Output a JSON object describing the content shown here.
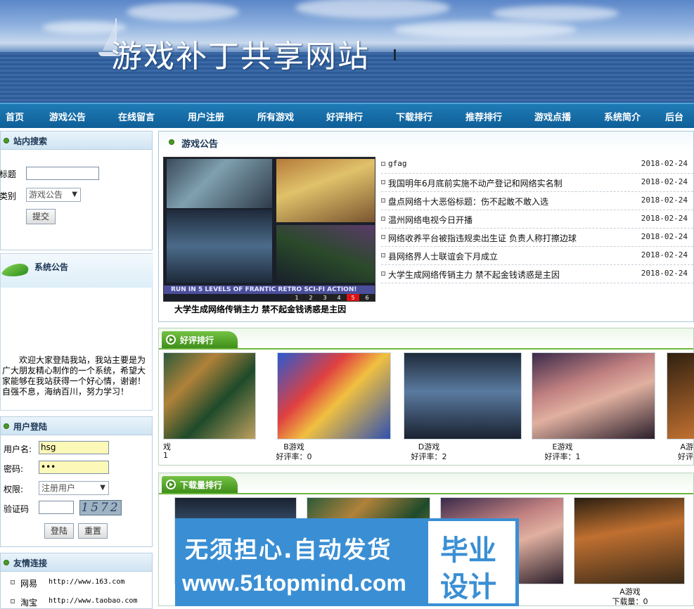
{
  "site_title": "游戏补丁共享网站",
  "nav": [
    "首页",
    "游戏公告",
    "在线留言",
    "用户注册",
    "所有游戏",
    "好评排行",
    "下载排行",
    "推荐排行",
    "游戏点播",
    "系统简介",
    "后台"
  ],
  "search": {
    "heading": "站内搜索",
    "title_label": "标题",
    "category_label": "类别",
    "category_value": "游戏公告",
    "submit_label": "提交"
  },
  "announcement": {
    "heading": "系统公告",
    "text": "欢迎大家登陆我站，我站主要是为广大朋友精心制作的一个系统，希望大家能够在我站获得一个好心情，谢谢！ 自强不息，海纳百川，努力学习！"
  },
  "login": {
    "heading": "用户登陆",
    "username_label": "用户名:",
    "username_value": "hsg",
    "password_label": "密码:",
    "password_value": "•••",
    "role_label": "权限:",
    "role_value": "注册用户",
    "captcha_label": "验证码",
    "captcha_value": "1572",
    "login_button": "登陆",
    "reset_button": "重置"
  },
  "links": {
    "heading": "友情连接",
    "items": [
      {
        "name": "网易",
        "url": "http://www.163.com"
      },
      {
        "name": "淘宝",
        "url": "http://www.taobao.com"
      }
    ]
  },
  "news": {
    "heading": "游戏公告",
    "image_caption": "大学生成网络传销主力 禁不起金钱诱惑是主因",
    "banner_text": "RUN IN 5 LEVELS OF FRANTIC RETRO SCI-FI ACTION!",
    "pager": [
      "1",
      "2",
      "3",
      "4",
      "5",
      "6"
    ],
    "items": [
      {
        "title": "gfag",
        "date": "2018-02-24"
      },
      {
        "title": "我国明年6月底前实施不动产登记和网络实名制",
        "date": "2018-02-24"
      },
      {
        "title": "盘点网络十大恶俗标题：伤不起敢不敢入选",
        "date": "2018-02-24"
      },
      {
        "title": "温州网络电视今日开播",
        "date": "2018-02-24"
      },
      {
        "title": "网络收养平台被指违规卖出生证 负责人称打擦边球",
        "date": "2018-02-24"
      },
      {
        "title": "县网络界人士联谊会下月成立",
        "date": "2018-02-24"
      },
      {
        "title": "大学生成网络传销主力 禁不起金钱诱惑是主因",
        "date": "2018-02-24"
      }
    ]
  },
  "rating": {
    "heading": "好评排行",
    "captions": [
      {
        "name": "戏",
        "sub": "1"
      },
      {
        "name": "B游戏",
        "sub": "好评率：0"
      },
      {
        "name": "D游戏",
        "sub": "好评率：2"
      },
      {
        "name": "E游戏",
        "sub": "好评率：1"
      },
      {
        "name": "A游",
        "sub": "好评"
      }
    ]
  },
  "downloads": {
    "heading": "下载量排行",
    "last_name": "A游戏",
    "last_count": "下载量：0"
  },
  "watermark": {
    "line1": "无须担心.自动发货",
    "line2": "www.51topmind.com",
    "box_top": "毕业",
    "box_bottom": "设计"
  }
}
